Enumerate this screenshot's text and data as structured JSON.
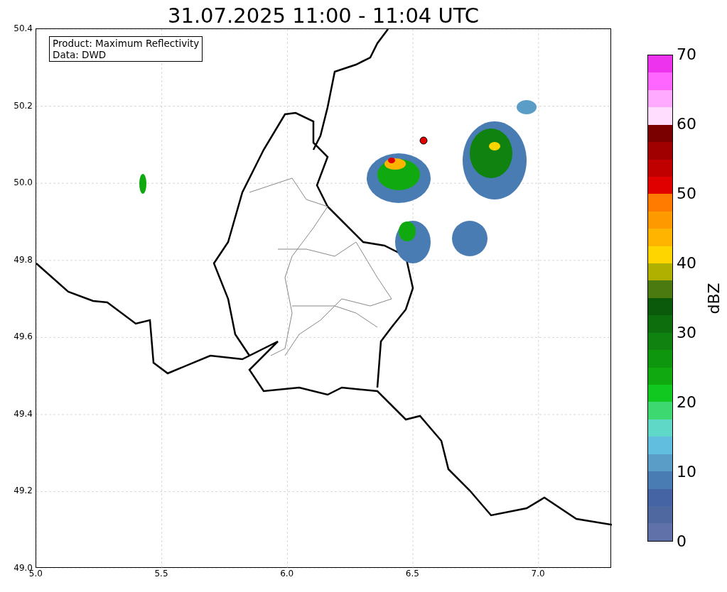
{
  "title": "31.07.2025 11:00 - 11:04 UTC",
  "legend": {
    "lines": [
      "Product: Maximum Reflectivity",
      "Data: DWD"
    ]
  },
  "x_ticks": [
    "5.0",
    "5.5",
    "6.0",
    "6.5",
    "7.0"
  ],
  "y_ticks": [
    "50.4",
    "50.2",
    "50.0",
    "49.8",
    "49.6",
    "49.4",
    "49.2",
    "49.0"
  ],
  "colorbar": {
    "label": "dBZ",
    "ticks": [
      "70",
      "60",
      "50",
      "40",
      "30",
      "20",
      "10",
      "0"
    ],
    "segments": [
      {
        "color": "#ee33ee"
      },
      {
        "color": "#ff66ff"
      },
      {
        "color": "#ffaaff"
      },
      {
        "color": "#ffddff"
      },
      {
        "color": "#7a0000"
      },
      {
        "color": "#a00000"
      },
      {
        "color": "#c00000"
      },
      {
        "color": "#e00000"
      },
      {
        "color": "#ff7b00"
      },
      {
        "color": "#ff9900"
      },
      {
        "color": "#ffb500"
      },
      {
        "color": "#ffd500"
      },
      {
        "color": "#b0b000"
      },
      {
        "color": "#4a7a10"
      },
      {
        "color": "#0b5a0b"
      },
      {
        "color": "#0d6e0d"
      },
      {
        "color": "#0f820f"
      },
      {
        "color": "#0e960e"
      },
      {
        "color": "#10aa10"
      },
      {
        "color": "#10c820"
      },
      {
        "color": "#3ed870"
      },
      {
        "color": "#60d8c8"
      },
      {
        "color": "#62bede"
      },
      {
        "color": "#5a9ec8"
      },
      {
        "color": "#4a7cb4"
      },
      {
        "color": "#4464a4"
      },
      {
        "color": "#5068a0"
      },
      {
        "color": "#6070a8"
      }
    ]
  }
}
